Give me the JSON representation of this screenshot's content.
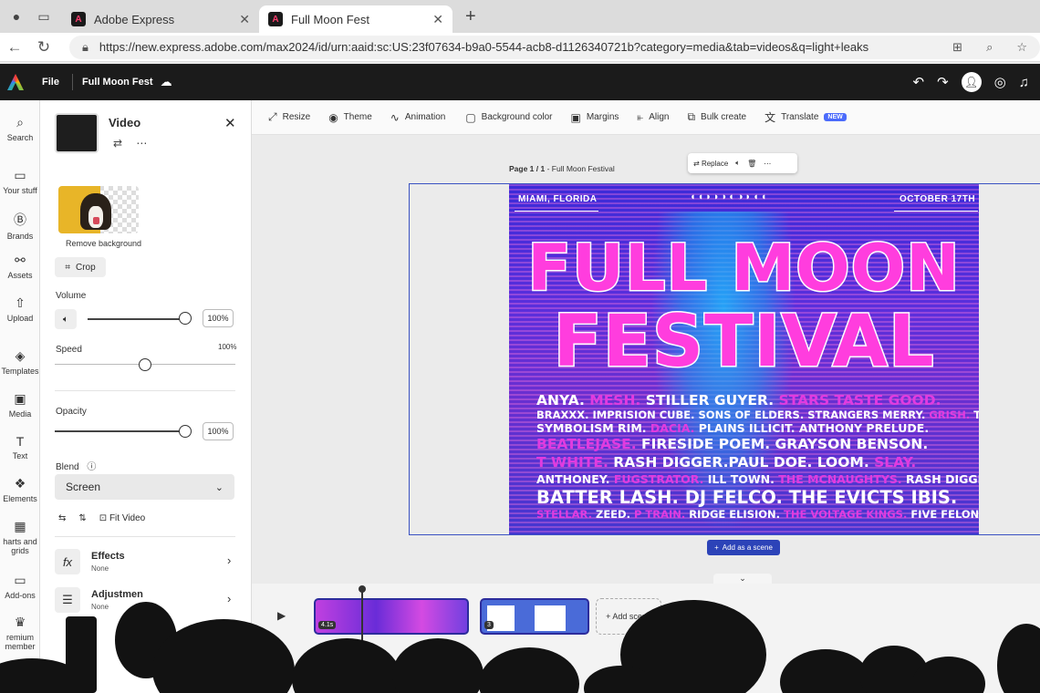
{
  "browser": {
    "tabs": [
      {
        "title": "Adobe Express",
        "active": false
      },
      {
        "title": "Full Moon Fest",
        "active": true
      }
    ],
    "url": "https://new.express.adobe.com/max2024/id/urn:aaid:sc:US:23f07634-b9a0-5544-acb8-d1126340721b?category=media&tab=videos&q=light+leaks"
  },
  "header": {
    "file_label": "File",
    "project_name": "Full Moon Fest"
  },
  "rail": {
    "items": [
      "Search",
      "Your stuff",
      "Brands",
      "Assets",
      "Upload",
      "Templates",
      "Media",
      "Text",
      "Elements",
      "harts and grids",
      "Add-ons",
      "remium member"
    ]
  },
  "panel": {
    "title": "Video",
    "remove_bg": "Remove background",
    "crop": "Crop",
    "volume_label": "Volume",
    "volume_value": "100%",
    "volume_level": 1.0,
    "speed_label": "Speed",
    "speed_value": "100%",
    "speed_level": 0.5,
    "opacity_label": "Opacity",
    "opacity_value": "100%",
    "opacity_level": 1.0,
    "blend_label": "Blend",
    "blend_value": "Screen",
    "fit_video": "Fit Video",
    "effects_label": "Effects",
    "effects_value": "None",
    "adjust_label": "Adjustmen",
    "adjust_value": "None"
  },
  "toolbar": {
    "resize": "Resize",
    "theme": "Theme",
    "animation": "Animation",
    "background": "Background color",
    "margins": "Margins",
    "align": "Align",
    "bulk": "Bulk create",
    "translate": "Translate",
    "new_badge": "NEW"
  },
  "canvas": {
    "page_label_bold": "Page 1 / 1",
    "page_label_rest": " - Full Moon Festival",
    "replace": "Replace",
    "add_scene": "Add as a scene"
  },
  "poster": {
    "location": "MIAMI, FLORIDA",
    "date": "OCTOBER 17TH",
    "moons": "◖◖◗◗◗◐◑◗◖◖",
    "title1": "FULL MOON",
    "title2": "FESTIVAL",
    "lineup": [
      [
        {
          "t": "ANYA. ",
          "p": false
        },
        {
          "t": "MESH. ",
          "p": true
        },
        {
          "t": "STILLER GUYER. ",
          "p": false
        },
        {
          "t": "STARS TASTE GOOD.",
          "p": true
        }
      ],
      [
        {
          "t": "BRAXXX. IMPRISION CUBE. SONS OF ELDERS. STRANGERS MERRY. ",
          "p": false
        },
        {
          "t": "GRISH. ",
          "p": true
        },
        {
          "t": "THE",
          "p": false
        }
      ],
      [
        {
          "t": "SYMBOLISM RIM. ",
          "p": false
        },
        {
          "t": "DACIA. ",
          "p": true
        },
        {
          "t": "PLAINS ILLICIT. ANTHONY PRELUDE.",
          "p": false
        }
      ],
      [
        {
          "t": "BEATLEJASE. ",
          "p": true
        },
        {
          "t": "FIRESIDE POEM. GRAYSON BENSON.",
          "p": false
        }
      ],
      [
        {
          "t": "T WHITE. ",
          "p": true
        },
        {
          "t": "RASH DIGGER.PAUL DOE. LOOM. ",
          "p": false
        },
        {
          "t": "SLAY.",
          "p": true
        }
      ],
      [
        {
          "t": "ANTHONEY. ",
          "p": false
        },
        {
          "t": "FUGSTRATOR. ",
          "p": true
        },
        {
          "t": "ILL TOWN. ",
          "p": false
        },
        {
          "t": "THE MCNAUGHTYS. ",
          "p": true
        },
        {
          "t": "RASH DIGGER.",
          "p": false
        }
      ],
      [
        {
          "t": "BATTER LASH. DJ FELCO. THE EVICTS IBIS.",
          "p": false
        }
      ],
      [
        {
          "t": "STELLAR. ",
          "p": true
        },
        {
          "t": "ZEED. ",
          "p": false
        },
        {
          "t": "P TRAIN. ",
          "p": true
        },
        {
          "t": "RIDGE ELISION. ",
          "p": false
        },
        {
          "t": "THE VOLTAGE KINGS. ",
          "p": true
        },
        {
          "t": "FIVE FELONS.",
          "p": false
        }
      ]
    ]
  },
  "timeline": {
    "clip1_duration": "4.1s",
    "clip2_duration": "3",
    "add_scene": "+ Add scene"
  },
  "colors": {
    "accent": "#2c43b8",
    "poster_pink": "#ff3dde",
    "poster_blue": "#3c2bd8",
    "header_bg": "#1b1b1b"
  }
}
